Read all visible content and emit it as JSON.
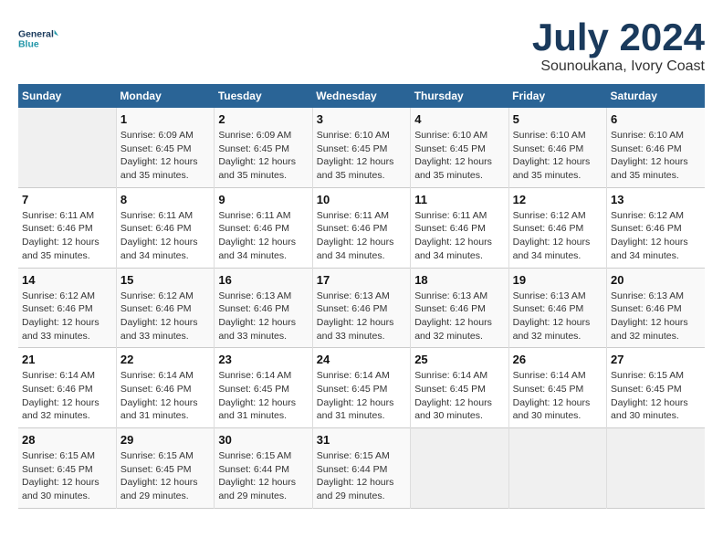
{
  "header": {
    "logo_line1": "General",
    "logo_line2": "Blue",
    "month": "July 2024",
    "location": "Sounoukana, Ivory Coast"
  },
  "days_of_week": [
    "Sunday",
    "Monday",
    "Tuesday",
    "Wednesday",
    "Thursday",
    "Friday",
    "Saturday"
  ],
  "weeks": [
    [
      {
        "day": "",
        "info": ""
      },
      {
        "day": "1",
        "info": "Sunrise: 6:09 AM\nSunset: 6:45 PM\nDaylight: 12 hours\nand 35 minutes."
      },
      {
        "day": "2",
        "info": "Sunrise: 6:09 AM\nSunset: 6:45 PM\nDaylight: 12 hours\nand 35 minutes."
      },
      {
        "day": "3",
        "info": "Sunrise: 6:10 AM\nSunset: 6:45 PM\nDaylight: 12 hours\nand 35 minutes."
      },
      {
        "day": "4",
        "info": "Sunrise: 6:10 AM\nSunset: 6:45 PM\nDaylight: 12 hours\nand 35 minutes."
      },
      {
        "day": "5",
        "info": "Sunrise: 6:10 AM\nSunset: 6:46 PM\nDaylight: 12 hours\nand 35 minutes."
      },
      {
        "day": "6",
        "info": "Sunrise: 6:10 AM\nSunset: 6:46 PM\nDaylight: 12 hours\nand 35 minutes."
      }
    ],
    [
      {
        "day": "7",
        "info": "Sunrise: 6:11 AM\nSunset: 6:46 PM\nDaylight: 12 hours\nand 35 minutes."
      },
      {
        "day": "8",
        "info": "Sunrise: 6:11 AM\nSunset: 6:46 PM\nDaylight: 12 hours\nand 34 minutes."
      },
      {
        "day": "9",
        "info": "Sunrise: 6:11 AM\nSunset: 6:46 PM\nDaylight: 12 hours\nand 34 minutes."
      },
      {
        "day": "10",
        "info": "Sunrise: 6:11 AM\nSunset: 6:46 PM\nDaylight: 12 hours\nand 34 minutes."
      },
      {
        "day": "11",
        "info": "Sunrise: 6:11 AM\nSunset: 6:46 PM\nDaylight: 12 hours\nand 34 minutes."
      },
      {
        "day": "12",
        "info": "Sunrise: 6:12 AM\nSunset: 6:46 PM\nDaylight: 12 hours\nand 34 minutes."
      },
      {
        "day": "13",
        "info": "Sunrise: 6:12 AM\nSunset: 6:46 PM\nDaylight: 12 hours\nand 34 minutes."
      }
    ],
    [
      {
        "day": "14",
        "info": "Sunrise: 6:12 AM\nSunset: 6:46 PM\nDaylight: 12 hours\nand 33 minutes."
      },
      {
        "day": "15",
        "info": "Sunrise: 6:12 AM\nSunset: 6:46 PM\nDaylight: 12 hours\nand 33 minutes."
      },
      {
        "day": "16",
        "info": "Sunrise: 6:13 AM\nSunset: 6:46 PM\nDaylight: 12 hours\nand 33 minutes."
      },
      {
        "day": "17",
        "info": "Sunrise: 6:13 AM\nSunset: 6:46 PM\nDaylight: 12 hours\nand 33 minutes."
      },
      {
        "day": "18",
        "info": "Sunrise: 6:13 AM\nSunset: 6:46 PM\nDaylight: 12 hours\nand 32 minutes."
      },
      {
        "day": "19",
        "info": "Sunrise: 6:13 AM\nSunset: 6:46 PM\nDaylight: 12 hours\nand 32 minutes."
      },
      {
        "day": "20",
        "info": "Sunrise: 6:13 AM\nSunset: 6:46 PM\nDaylight: 12 hours\nand 32 minutes."
      }
    ],
    [
      {
        "day": "21",
        "info": "Sunrise: 6:14 AM\nSunset: 6:46 PM\nDaylight: 12 hours\nand 32 minutes."
      },
      {
        "day": "22",
        "info": "Sunrise: 6:14 AM\nSunset: 6:46 PM\nDaylight: 12 hours\nand 31 minutes."
      },
      {
        "day": "23",
        "info": "Sunrise: 6:14 AM\nSunset: 6:45 PM\nDaylight: 12 hours\nand 31 minutes."
      },
      {
        "day": "24",
        "info": "Sunrise: 6:14 AM\nSunset: 6:45 PM\nDaylight: 12 hours\nand 31 minutes."
      },
      {
        "day": "25",
        "info": "Sunrise: 6:14 AM\nSunset: 6:45 PM\nDaylight: 12 hours\nand 30 minutes."
      },
      {
        "day": "26",
        "info": "Sunrise: 6:14 AM\nSunset: 6:45 PM\nDaylight: 12 hours\nand 30 minutes."
      },
      {
        "day": "27",
        "info": "Sunrise: 6:15 AM\nSunset: 6:45 PM\nDaylight: 12 hours\nand 30 minutes."
      }
    ],
    [
      {
        "day": "28",
        "info": "Sunrise: 6:15 AM\nSunset: 6:45 PM\nDaylight: 12 hours\nand 30 minutes."
      },
      {
        "day": "29",
        "info": "Sunrise: 6:15 AM\nSunset: 6:45 PM\nDaylight: 12 hours\nand 29 minutes."
      },
      {
        "day": "30",
        "info": "Sunrise: 6:15 AM\nSunset: 6:44 PM\nDaylight: 12 hours\nand 29 minutes."
      },
      {
        "day": "31",
        "info": "Sunrise: 6:15 AM\nSunset: 6:44 PM\nDaylight: 12 hours\nand 29 minutes."
      },
      {
        "day": "",
        "info": ""
      },
      {
        "day": "",
        "info": ""
      },
      {
        "day": "",
        "info": ""
      }
    ]
  ]
}
